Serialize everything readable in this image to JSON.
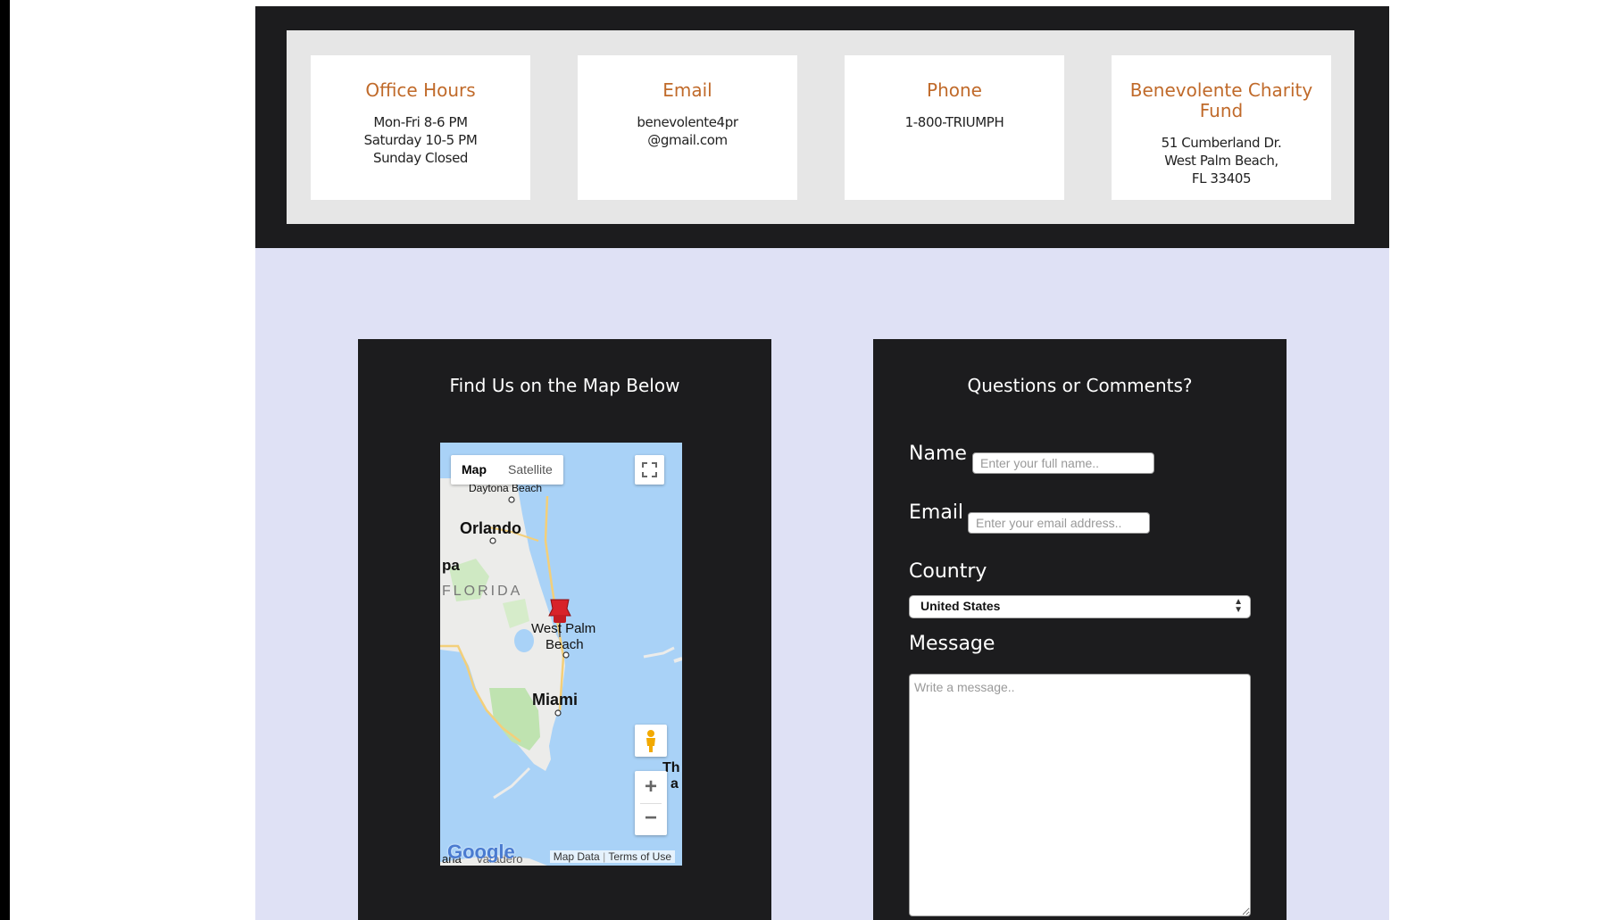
{
  "contact_cards": [
    {
      "title": "Office Hours",
      "lines": [
        "Mon-Fri 8-6 PM",
        "Saturday 10-5 PM",
        "Sunday Closed"
      ]
    },
    {
      "title": "Email",
      "lines": [
        "benevolente4pr",
        "@gmail.com"
      ]
    },
    {
      "title": "Phone",
      "lines": [
        "1-800-TRIUMPH"
      ]
    },
    {
      "title": "Benevolente Charity Fund",
      "lines": [
        "51 Cumberland Dr.",
        "West Palm Beach,",
        "FL 33405"
      ]
    }
  ],
  "map_section": {
    "heading": "Find Us on the Map Below",
    "map_type_map": "Map",
    "map_type_satellite": "Satellite",
    "labels": {
      "daytona": "Daytona Beach",
      "orlando": "Orlando",
      "pa": "pa",
      "florida": "FLORIDA",
      "wpb_line1": "West Palm",
      "wpb_line2": "Beach",
      "miami": "Miami",
      "th": "Th",
      "a": "a",
      "ana": "ana",
      "varadero": "Varadero"
    },
    "zoom_in": "+",
    "zoom_out": "−",
    "google_logo": "Google",
    "map_data": "Map Data",
    "terms": "Terms of Use"
  },
  "form_section": {
    "heading": "Questions or Comments?",
    "name_label": "Name",
    "name_placeholder": "Enter your full name..",
    "email_label": "Email",
    "email_placeholder": "Enter your email address..",
    "country_label": "Country",
    "country_selected": "United States",
    "message_label": "Message",
    "message_placeholder": "Write a message.."
  },
  "colors": {
    "accent": "#c06a2a",
    "dark_bg": "#1c1c1e",
    "lavender_bg": "#dfe1f5"
  }
}
